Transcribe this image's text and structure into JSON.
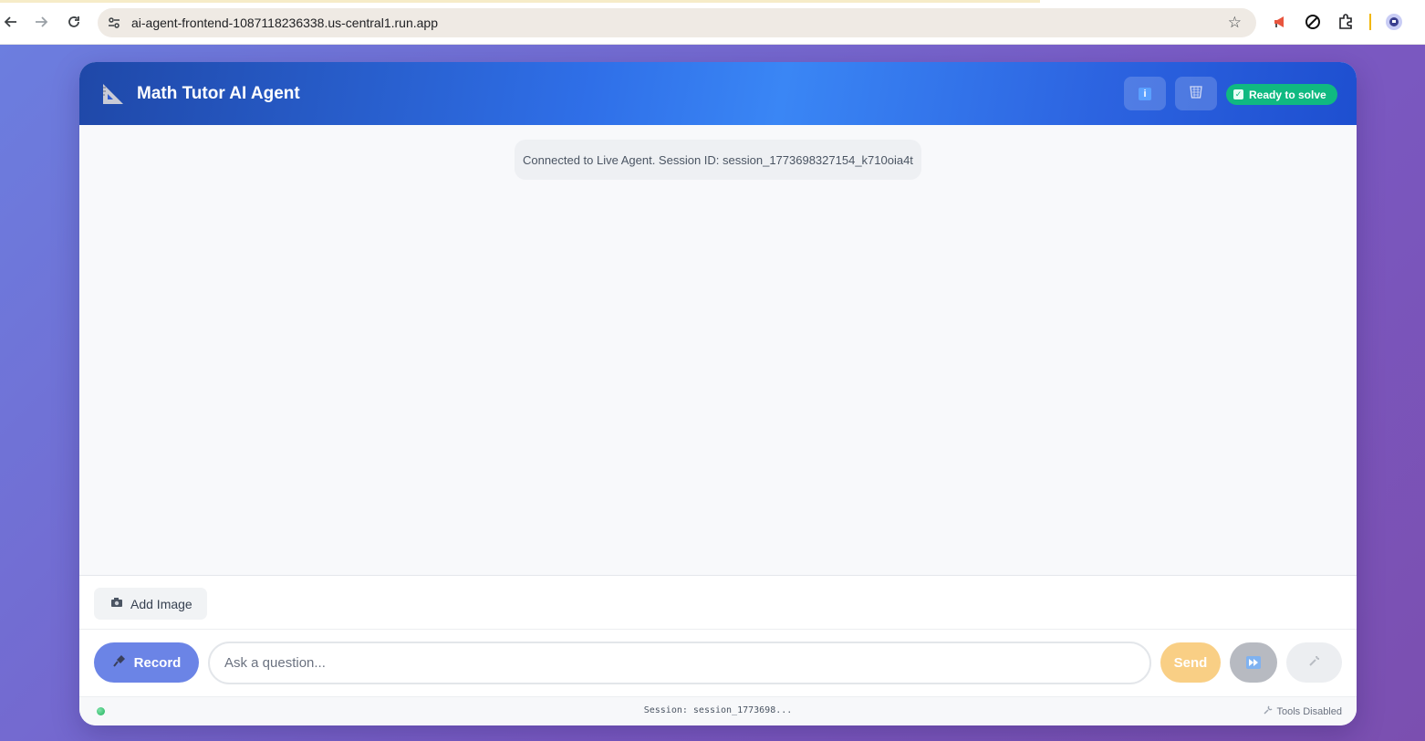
{
  "browser": {
    "url": "ai-agent-frontend-1087118236338.us-central1.run.app",
    "icons": [
      "back-arrow-icon",
      "forward-arrow-icon",
      "reload-icon",
      "site-settings-icon",
      "bookmark-star-icon",
      "megaphone-extension-icon",
      "block-extension-icon",
      "puzzle-extensions-icon",
      "profile-avatar-icon"
    ]
  },
  "header": {
    "title": "Math Tutor AI Agent",
    "status": "Ready to solve",
    "status_color": "#10b981",
    "info_glyph": "i"
  },
  "messages": {
    "system": "Connected to Live Agent. Session ID: session_1773698327154_k710oia4t"
  },
  "upload": {
    "add_image_label": "Add Image"
  },
  "input": {
    "record_label": "Record",
    "placeholder": "Ask a question...",
    "value": "",
    "send_label": "Send"
  },
  "footer": {
    "session": "Session: session_1773698...",
    "tools": "Tools Disabled"
  },
  "colors": {
    "accent": "#2f6fe8",
    "record": "#6b84e6",
    "send": "#f9cf85",
    "status_dot": "#22b35e"
  }
}
